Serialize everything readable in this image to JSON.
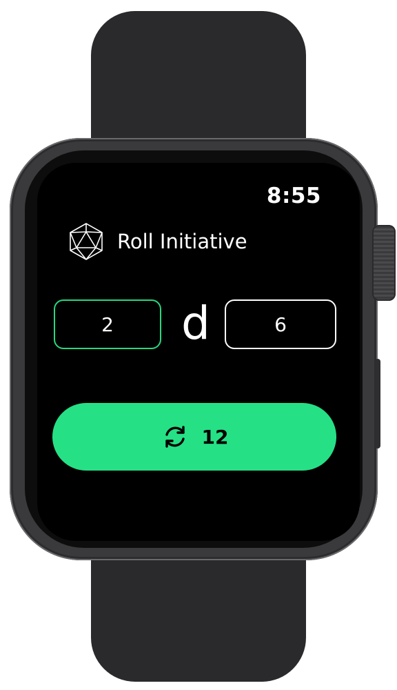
{
  "status_bar": {
    "time": "8:55"
  },
  "app": {
    "title": "Roll Initiative",
    "logo_icon": "d20-dice-icon"
  },
  "dice_input": {
    "count": "2",
    "separator": "d",
    "sides": "6"
  },
  "roll_button": {
    "icon": "refresh-icon",
    "result": "12"
  },
  "colors": {
    "accent": "#26e086",
    "field_active_border": "#26d97f",
    "field_border": "#ffffff",
    "screen_bg": "#000000"
  }
}
